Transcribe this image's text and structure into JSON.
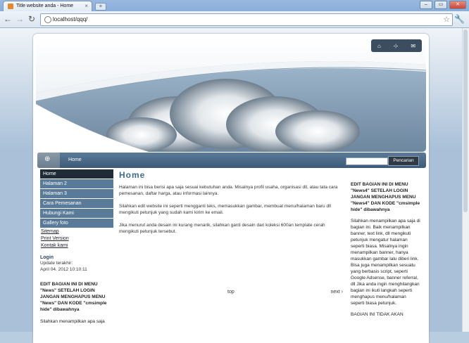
{
  "browser": {
    "tab_title": "Title website anda - Home",
    "tab_close": "×",
    "new_tab": "+",
    "url": "localhost/qqq/",
    "window_buttons": [
      "–",
      "▭",
      "✕"
    ],
    "icons": {
      "back": "back-arrow-icon",
      "forward": "forward-arrow-icon",
      "reload": "reload-icon",
      "star": "star-icon",
      "wrench": "wrench-icon"
    }
  },
  "banner": {
    "top_icons": [
      "⌂",
      "⊹",
      "✉"
    ]
  },
  "menubar": {
    "home_icon": "⊕",
    "current": "Home",
    "search_button": "Pencarian"
  },
  "sidebar": {
    "items": [
      "Home",
      "Halaman 2",
      "Halaman 3",
      "Cara Pemesanan",
      "Hubungi Kami",
      "Gallery foto"
    ],
    "links": [
      "Sitemap",
      "Print Version",
      "Kontak kami"
    ],
    "login_title": "Login",
    "update_label": "Update terakhir:",
    "update_value": "April 04. 2012 10:10:11",
    "edit_note": "EDIT BAGIAN INI DI MENU \"News\" SETELAH LOGIN JANGAN MENGHAPUS MENU \"News\" DAN KODE \"cmsimple hide\" dibawahnya",
    "text": "Silahkan menampilkan apa saja"
  },
  "main": {
    "heading": "Home",
    "p1": "Halaman ini bisa berisi apa saja sesuai kebutuhan anda. Misalnya profil usaha, organisasi dll, atau tata cara pemesanan, daftar harga, atau informasi lainnya.",
    "p2": "Silahkan edit website ini seperti mengganti teks, memasukkan gambar, membuat menu/halaman baru dll mengikuti petunjuk yang sudah kami kirim ke email.",
    "p3": "Jika menurut anda desain ini kurang menarik, silahkan ganti desain dari koleksi 600an template cerah mengikuti petunjuk tersebut.",
    "top_link": "top",
    "next_link": "next ›"
  },
  "right": {
    "head": "EDIT BAGIAN INI DI MENU \"News4\" SETELAH LOGIN JANGAN MENGHAPUS MENU \"News4\" DAN KODE \"cmsimple hide\" dibawahnya",
    "text": "Silahkan menampilkan apa saja di bagian ini. Baik menampilkan banner, text link, dll mengikuti petunjuk mengatur halaman seperti biasa. Misalnya ingin menampilkan banner, hanya masukkan gambar lalu diberi link. Bisa juga menampilkan sesuatu yang berbasis script, seperti Google Adsense, banner referral, dll Jika anda ingin menghilangkan bagian ini ikuti langkah seperti menghapus menu/halaman seperti biasa petunjuk.",
    "text2": "BAGIAN INI TIDAK AKAN"
  }
}
